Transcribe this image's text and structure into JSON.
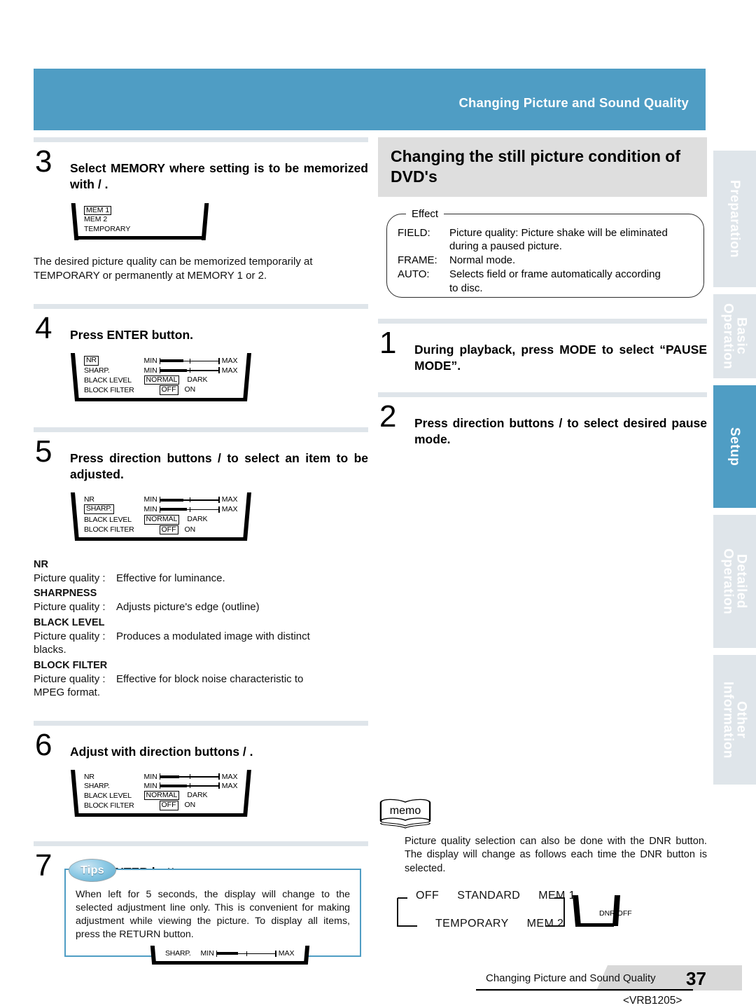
{
  "header": {
    "title": "Changing Picture and Sound Quality",
    "bar_color": "#4f9dc4"
  },
  "side_tabs": [
    {
      "label": "Preparation",
      "active": false
    },
    {
      "label": "Basic\nOperation",
      "active": false
    },
    {
      "label": "Setup",
      "active": true
    },
    {
      "label": "Detailed\nOperation",
      "active": false
    },
    {
      "label": "Other\nInformation",
      "active": false
    }
  ],
  "left_column": {
    "step3": {
      "number": "3",
      "text": "Select MEMORY where setting is to be memorized with    / .",
      "display": {
        "items": [
          {
            "label": "MEM 1",
            "highlighted": true
          },
          {
            "label": "MEM 2",
            "highlighted": false
          },
          {
            "label": "TEMPORARY",
            "highlighted": false
          }
        ]
      },
      "note": "The desired picture quality can be memorized temporarily at TEMPORARY or permanently at MEMORY 1 or 2."
    },
    "step4": {
      "number": "4",
      "text": "Press ENTER button.",
      "display": {
        "rows": [
          {
            "label": "NR",
            "highlighted": true,
            "type": "slider",
            "min": "MIN",
            "max": "MAX",
            "fill": 40
          },
          {
            "label": "SHARP.",
            "highlighted": false,
            "type": "slider",
            "min": "MIN",
            "max": "MAX",
            "fill": 46
          },
          {
            "label": "BLACK LEVEL",
            "highlighted": false,
            "type": "choice",
            "options": [
              "NORMAL",
              "DARK"
            ],
            "selected": "NORMAL"
          },
          {
            "label": "BLOCK FILTER",
            "highlighted": false,
            "type": "choice",
            "options": [
              "OFF",
              "ON"
            ],
            "selected": "OFF"
          }
        ]
      }
    },
    "step5": {
      "number": "5",
      "text": "Press direction buttons    /    to select an item to be adjusted.",
      "display": {
        "rows": [
          {
            "label": "NR",
            "highlighted": false,
            "type": "slider",
            "min": "MIN",
            "max": "MAX",
            "fill": 40
          },
          {
            "label": "SHARP.",
            "highlighted": true,
            "type": "slider",
            "min": "MIN",
            "max": "MAX",
            "fill": 46
          },
          {
            "label": "BLACK LEVEL",
            "highlighted": false,
            "type": "choice",
            "options": [
              "NORMAL",
              "DARK"
            ],
            "selected": "NORMAL"
          },
          {
            "label": "BLOCK FILTER",
            "highlighted": false,
            "type": "choice",
            "options": [
              "OFF",
              "ON"
            ],
            "selected": "OFF"
          }
        ]
      },
      "descriptions": [
        {
          "term": "NR",
          "key": "Picture quality :",
          "value": "Effective for luminance."
        },
        {
          "term": "SHARPNESS",
          "key": "Picture quality :",
          "value": "Adjusts picture's edge (outline)"
        },
        {
          "term": "BLACK LEVEL",
          "key": "Picture quality :",
          "value": "Produces a modulated image with distinct",
          "value2": "blacks."
        },
        {
          "term": "BLOCK FILTER",
          "key": "Picture quality :",
          "value": "Effective for block noise characteristic to",
          "value2": "MPEG format."
        }
      ]
    },
    "step6": {
      "number": "6",
      "text": "Adjust with direction buttons    / .",
      "display": {
        "rows": [
          {
            "label": "NR",
            "highlighted": false,
            "type": "slider",
            "min": "MIN",
            "max": "MAX",
            "fill": 33
          },
          {
            "label": "SHARP.",
            "highlighted": false,
            "type": "slider",
            "min": "MIN",
            "max": "MAX",
            "fill": 46
          },
          {
            "label": "BLACK LEVEL",
            "highlighted": false,
            "type": "choice",
            "options": [
              "NORMAL",
              "DARK"
            ],
            "selected": "NORMAL"
          },
          {
            "label": "BLOCK FILTER",
            "highlighted": false,
            "type": "choice",
            "options": [
              "OFF",
              "ON"
            ],
            "selected": "OFF"
          }
        ]
      }
    },
    "step7": {
      "number": "7",
      "text": "Press ENTER button."
    }
  },
  "right_column": {
    "section_title": "Changing the still picture condition of DVD's",
    "effect_box": {
      "label": "Effect",
      "rows": [
        {
          "key": "FIELD:",
          "value": "Picture quality: Picture shake will be eliminated",
          "value2": "during a paused picture."
        },
        {
          "key": "FRAME:",
          "value": "Normal mode.",
          "value2": ""
        },
        {
          "key": "AUTO:",
          "value": "Selects field or frame automatically according",
          "value2": "to disc."
        }
      ]
    },
    "step1": {
      "number": "1",
      "text": "During playback, press MODE to select “PAUSE MODE”."
    },
    "step2": {
      "number": "2",
      "text": "Press direction buttons    /    to select desired pause mode."
    }
  },
  "tips": {
    "badge": "Tips",
    "text": "When left for 5 seconds, the display will change to the selected adjustment line only. This is convenient for making adjustment while viewing the picture. To display all items, press the RETURN button.",
    "display": {
      "rows": [
        {
          "label": "SHARP.",
          "highlighted": false,
          "type": "slider",
          "min": "MIN",
          "max": "MAX",
          "fill": 36
        }
      ]
    }
  },
  "memo": {
    "badge": "memo",
    "text": "Picture quality selection can also be done with the DNR button. The display will change as follows each time the DNR button is selected.",
    "flow": {
      "row1": [
        "OFF",
        "STANDARD",
        "MEM 1"
      ],
      "row2": [
        "TEMPORARY",
        "MEM 2"
      ],
      "result": "DNR OFF"
    }
  },
  "footer": {
    "text": "Changing Picture and Sound Quality",
    "page_number": "37",
    "code": "<VRB1205>"
  }
}
